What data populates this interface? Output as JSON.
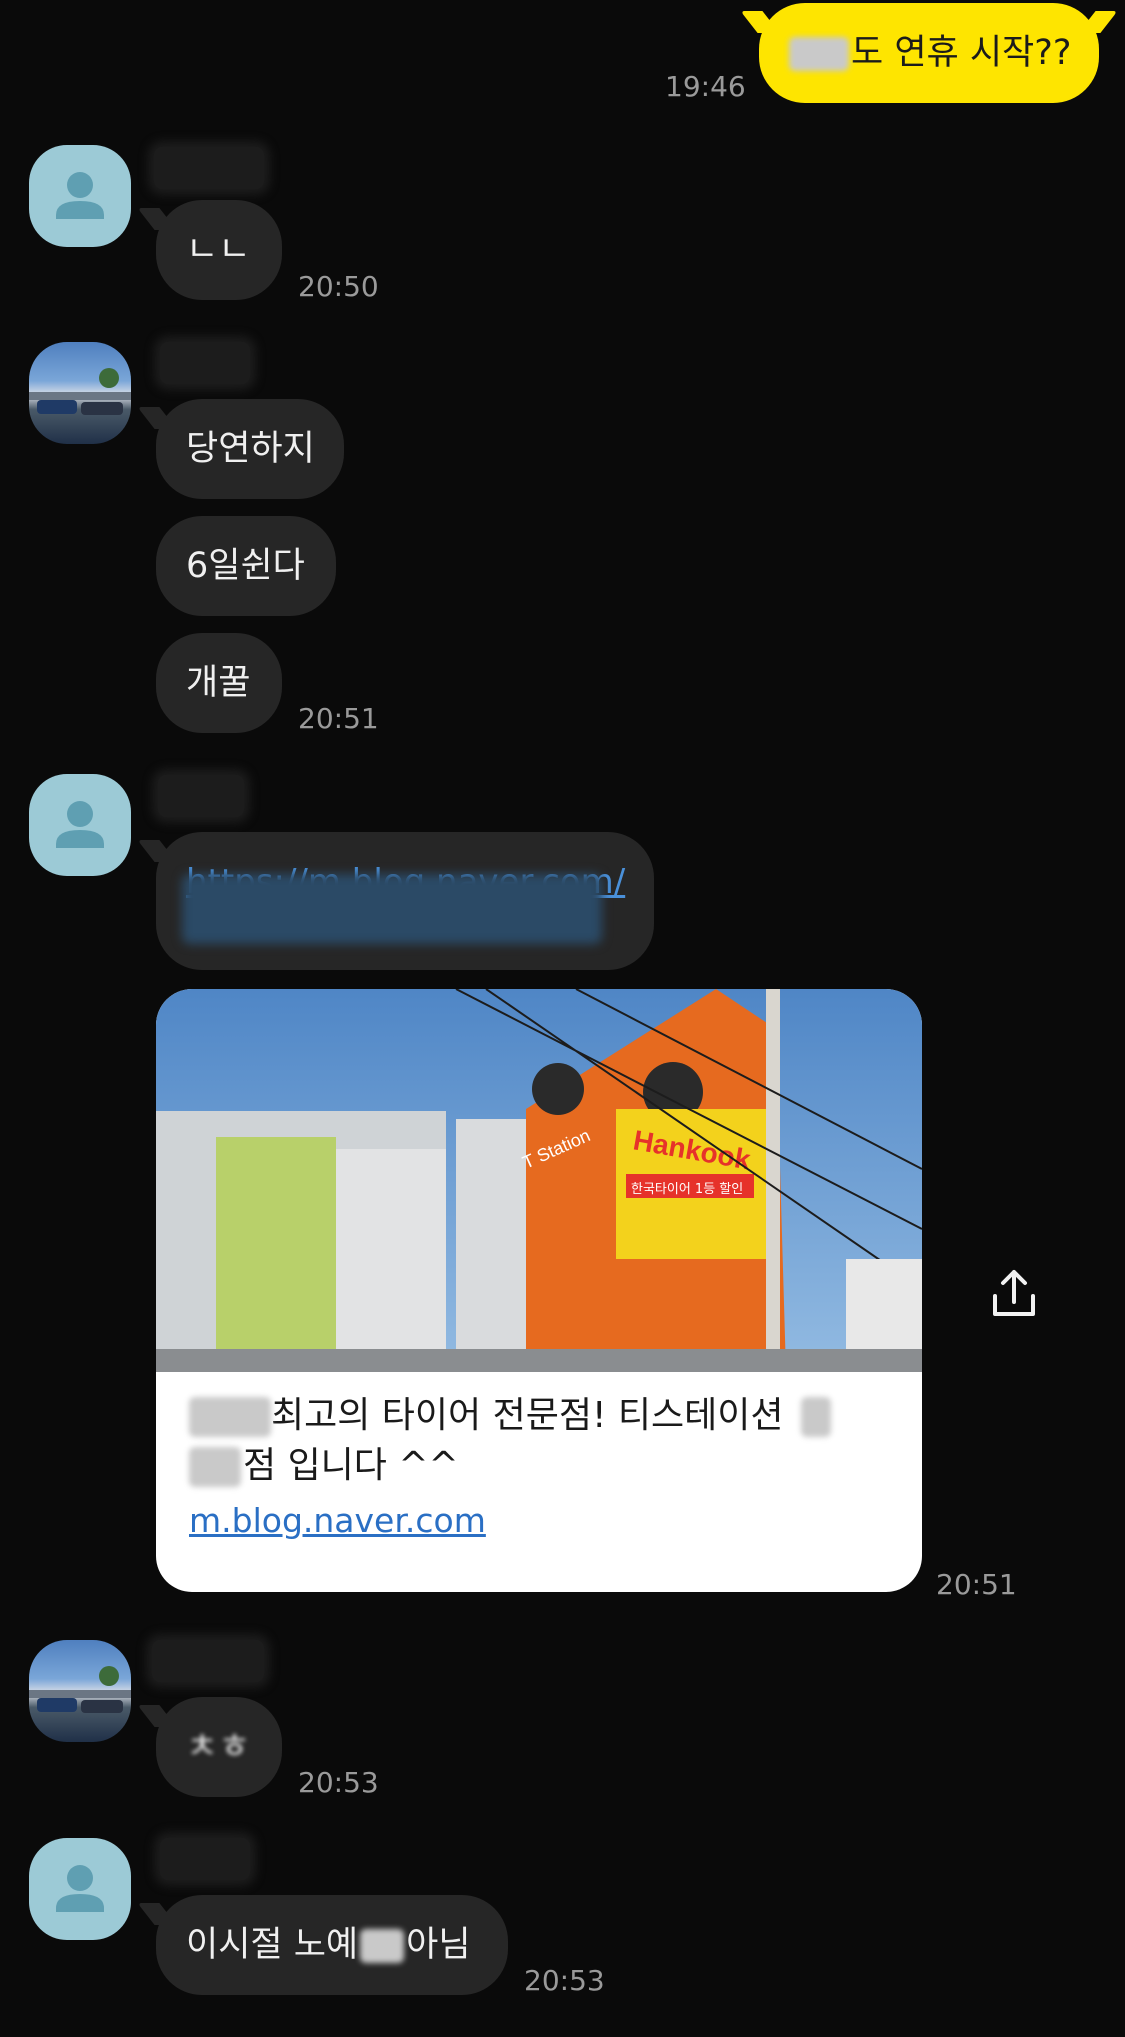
{
  "colors": {
    "background": "#0a0a0a",
    "my_bubble": "#fee500",
    "other_bubble": "#262626",
    "link": "#2a6fc4",
    "default_avatar": "#9ccad6"
  },
  "messages": {
    "m1": {
      "text": "도 연휴 시작??",
      "time": "19:46"
    },
    "m2": {
      "text": "ㄴㄴ",
      "time": "20:50"
    },
    "m3": {
      "text": "당연하지"
    },
    "m4": {
      "text": "6일쉰다"
    },
    "m5": {
      "text": "개꿀",
      "time": "20:51"
    },
    "m6": {
      "link_text": "https://m.blog.naver.com/"
    },
    "m7": {
      "card_title_1": "최고의 타이어 전문점! 티스테이션",
      "card_title_2": "점 입니다 ^^",
      "card_domain": "m.blog.naver.com",
      "time": "20:51",
      "image_sign": "T Station",
      "image_banner": "Hankook",
      "image_banner_sub": "한국타이어 1등 할인"
    },
    "m8": {
      "text": "ㅊㅎ",
      "time": "20:53"
    },
    "m9": {
      "text_before": "이시절 노예",
      "text_after": "아님",
      "time": "20:53"
    }
  },
  "icons": {
    "share": "share-icon",
    "default_avatar": "person-icon"
  }
}
